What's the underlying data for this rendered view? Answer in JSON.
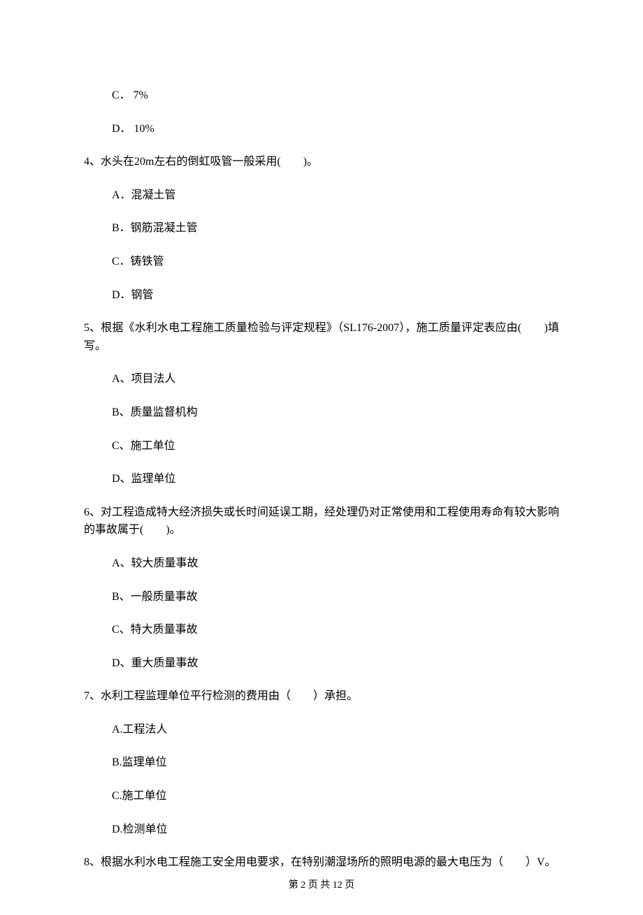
{
  "q3": {
    "opts": {
      "C": "C． 7%",
      "D": "D． 10%"
    }
  },
  "q4": {
    "text": "4、水头在20m左右的倒虹吸管一般采用(　　)。",
    "opts": {
      "A": "A．混凝土管",
      "B": "B．钢筋混凝土管",
      "C": "C．铸铁管",
      "D": "D．钢管"
    }
  },
  "q5": {
    "text": "5、根据《水利水电工程施工质量检验与评定规程》（SL176-2007），施工质量评定表应由(　　)填写。",
    "opts": {
      "A": "A、项目法人",
      "B": "B、质量监督机构",
      "C": "C、施工单位",
      "D": "D、监理单位"
    }
  },
  "q6": {
    "text": "6、对工程造成特大经济损失或长时间延误工期，经处理仍对正常使用和工程使用寿命有较大影响的事故属于(　　)。",
    "opts": {
      "A": "A、较大质量事故",
      "B": "B、一般质量事故",
      "C": "C、特大质量事故",
      "D": "D、重大质量事故"
    }
  },
  "q7": {
    "text": "7、水利工程监理单位平行检测的费用由（　　）承担。",
    "opts": {
      "A": "A.工程法人",
      "B": "B.监理单位",
      "C": "C.施工单位",
      "D": "D.检测单位"
    }
  },
  "q8": {
    "text": "8、根据水利水电工程施工安全用电要求，在特别潮湿场所的照明电源的最大电压为（　　）V。"
  },
  "footer": "第 2 页 共 12 页"
}
